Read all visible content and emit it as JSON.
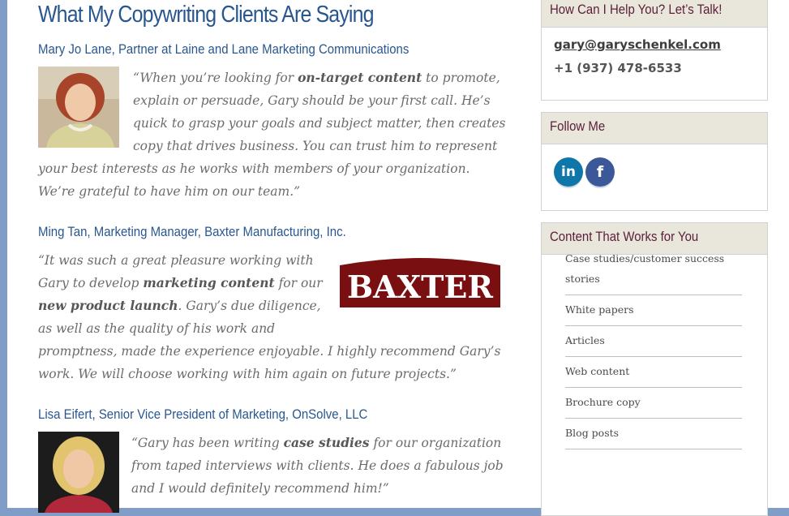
{
  "main": {
    "title": "What My Copywriting Clients Are Saying",
    "testimonials": [
      {
        "attribution": "Mary Jo Lane, Partner at Laine and Lane Marketing Communications",
        "lines": [
          [
            "“When you’re looking for ",
            {
              "b": "on-target content"
            },
            " to promote,"
          ],
          [
            "explain or persuade, Gary should be your first call. He’s"
          ],
          [
            "quick to grasp your goals and subject matter, then creates"
          ],
          [
            "copy that drives business. You can trust him to represent"
          ],
          [
            "your best interests as he works with members of your organization."
          ],
          [
            "We’re grateful to have him on our team.”"
          ]
        ]
      },
      {
        "attribution": "Ming Tan, Marketing Manager, Baxter Manufacturing, Inc.",
        "logo_text": "BAXTER",
        "lines": [
          [
            "“It was such a great pleasure working with"
          ],
          [
            "Gary to develop ",
            {
              "b": "marketing content"
            },
            " for our"
          ],
          [
            {
              "b": "new product launch"
            },
            ". Gary’s due diligence,"
          ],
          [
            "as well as the quality of his work and"
          ],
          [
            "promptness, made the experience enjoyable. I highly recommend Gary’s"
          ],
          [
            "work. We will choose working with him again on future projects.”"
          ]
        ]
      },
      {
        "attribution": "Lisa Eifert, Senior Vice President of Marketing, OnSolve, LLC",
        "lines": [
          [
            "“Gary has been writing ",
            {
              "b": "case studies"
            },
            " for our organization"
          ],
          [
            "from taped interviews with clients. He does a fabulous job"
          ],
          [
            "and I would definitely recommend him!”"
          ]
        ]
      }
    ]
  },
  "sidebar": {
    "contact": {
      "title": "How Can I Help You? Let’s Talk!",
      "email": "gary@garyschenkel.com",
      "phone": "+1 (937) 478-6533"
    },
    "follow": {
      "title": "Follow Me",
      "icons": [
        {
          "name": "linkedin-icon",
          "glyph": "in",
          "color": "#0e76a8"
        },
        {
          "name": "facebook-icon",
          "glyph": "f",
          "color": "#3b5998"
        }
      ]
    },
    "content": {
      "title": "Content That Works for You",
      "items": [
        "Case studies/customer success stories",
        "White papers",
        "Articles",
        "Web content",
        "Brochure copy",
        "Blog posts"
      ]
    }
  },
  "colors": {
    "accent_blue": "#28578f",
    "sidebar_title": "#5a1e3a",
    "logo_red": "#7a0f12",
    "page_border": "#7f9dc7"
  }
}
